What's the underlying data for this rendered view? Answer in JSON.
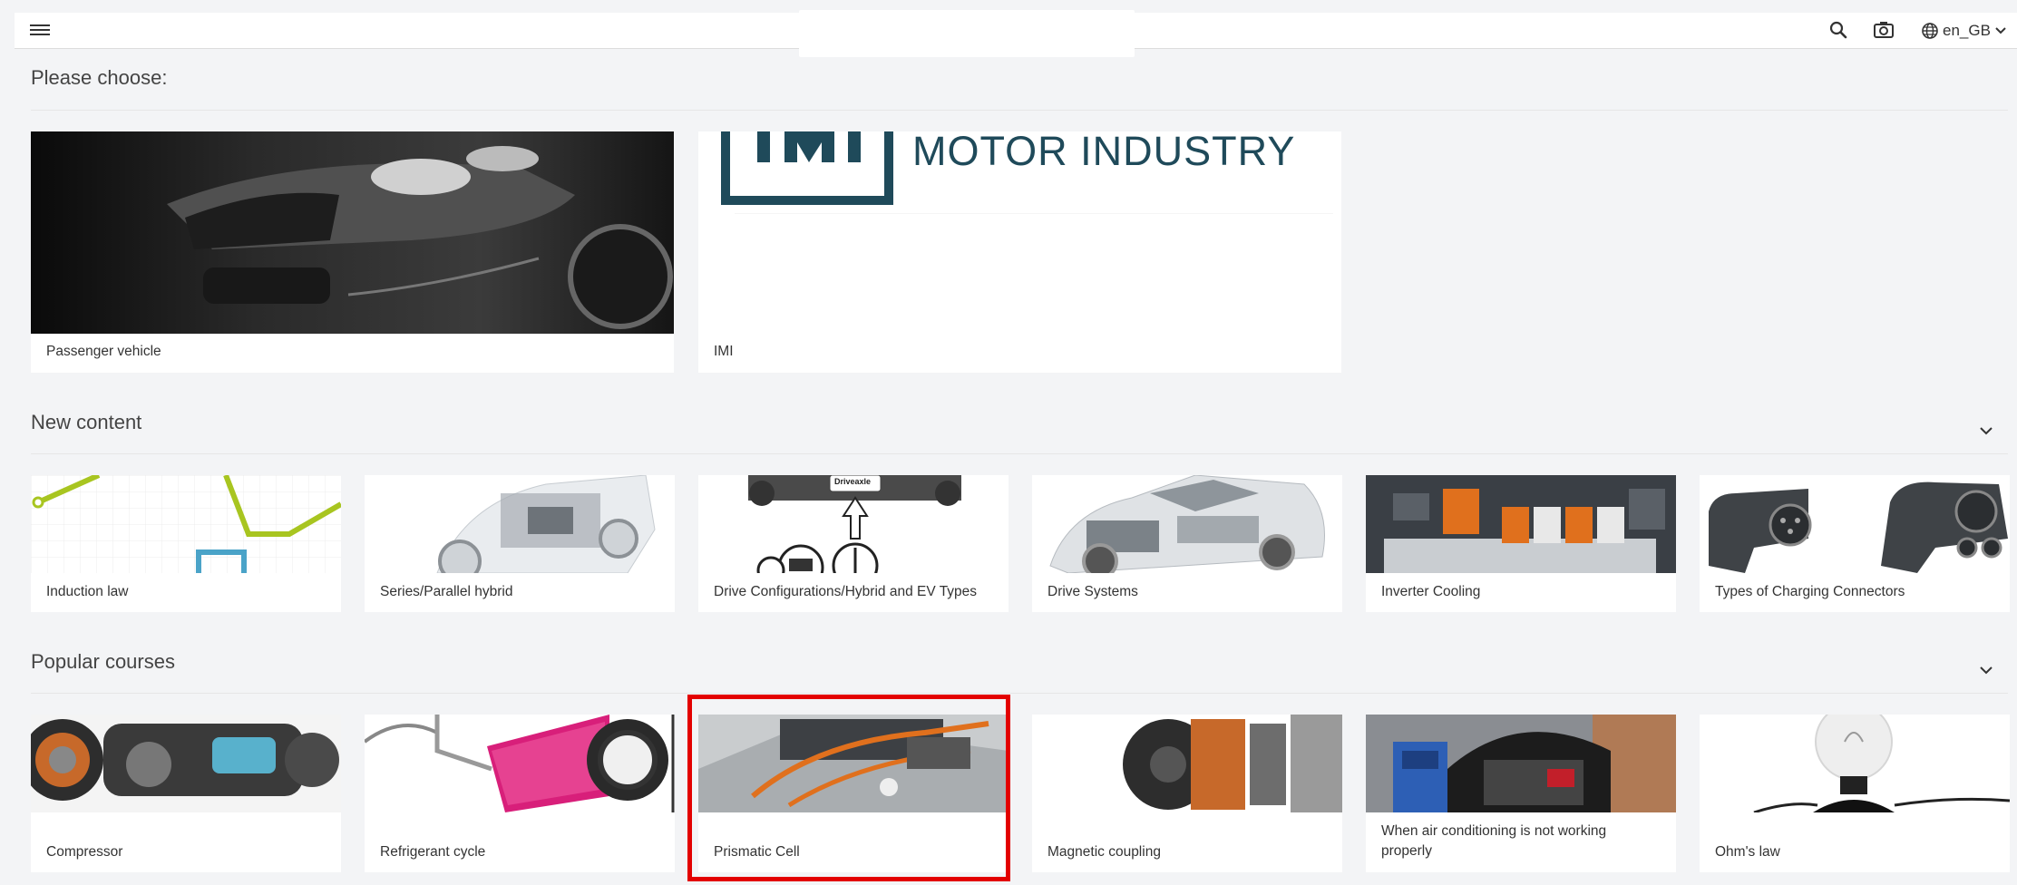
{
  "topbar": {
    "language": "en_GB",
    "icons": {
      "menu": "hamburger-icon",
      "search": "search-icon",
      "screenshot": "camera-icon",
      "language": "globe-icon",
      "dropdown": "chevron-down-icon"
    }
  },
  "choose": {
    "title": "Please choose:",
    "cards": [
      {
        "label": "Passenger vehicle"
      },
      {
        "label": "IMI",
        "logo_text": "MOTOR INDUSTRY",
        "logo_mark": "IMI"
      }
    ]
  },
  "new_content": {
    "title": "New content",
    "cards": [
      {
        "label": "Induction law"
      },
      {
        "label": "Series/Parallel hybrid"
      },
      {
        "label": "Drive Configurations/Hybrid and EV Types",
        "image_caption": "Driveaxle"
      },
      {
        "label": "Drive Systems"
      },
      {
        "label": "Inverter Cooling"
      },
      {
        "label": "Types of Charging Connectors"
      }
    ]
  },
  "popular": {
    "title": "Popular courses",
    "cards": [
      {
        "label": "Compressor"
      },
      {
        "label": "Refrigerant cycle"
      },
      {
        "label": "Prismatic Cell"
      },
      {
        "label": "Magnetic coupling"
      },
      {
        "label": "When air conditioning is not working properly"
      },
      {
        "label": "Ohm's law"
      }
    ]
  },
  "colors": {
    "background": "#f3f4f6",
    "highlight": "#e30000",
    "lime": "#a8c520",
    "cyan": "#4aa3c8",
    "orange": "#e0701d",
    "pink": "#d81f7a",
    "logo_teal": "#1f4a5a"
  }
}
